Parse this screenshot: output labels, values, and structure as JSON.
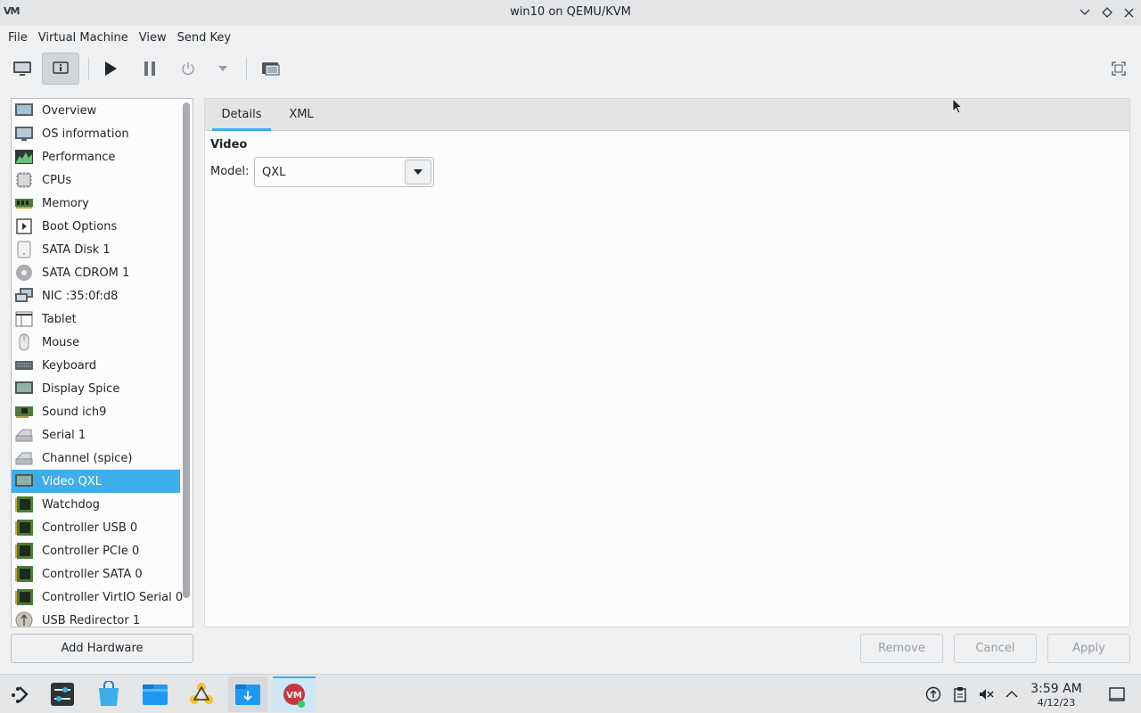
{
  "window": {
    "title": "win10 on QEMU/KVM",
    "logo_text": "VM"
  },
  "menubar": {
    "items": [
      "File",
      "Virtual Machine",
      "View",
      "Send Key"
    ]
  },
  "sidebar": {
    "items": [
      {
        "label": "Overview",
        "icon": "overview-icon"
      },
      {
        "label": "OS information",
        "icon": "os-info-icon"
      },
      {
        "label": "Performance",
        "icon": "performance-icon"
      },
      {
        "label": "CPUs",
        "icon": "cpu-icon"
      },
      {
        "label": "Memory",
        "icon": "memory-icon"
      },
      {
        "label": "Boot Options",
        "icon": "boot-options-icon"
      },
      {
        "label": "SATA Disk 1",
        "icon": "disk-icon"
      },
      {
        "label": "SATA CDROM 1",
        "icon": "cdrom-icon"
      },
      {
        "label": "NIC :35:0f:d8",
        "icon": "nic-icon"
      },
      {
        "label": "Tablet",
        "icon": "tablet-icon"
      },
      {
        "label": "Mouse",
        "icon": "mouse-icon"
      },
      {
        "label": "Keyboard",
        "icon": "keyboard-icon"
      },
      {
        "label": "Display Spice",
        "icon": "display-icon"
      },
      {
        "label": "Sound ich9",
        "icon": "sound-icon"
      },
      {
        "label": "Serial 1",
        "icon": "serial-icon"
      },
      {
        "label": "Channel (spice)",
        "icon": "channel-icon"
      },
      {
        "label": "Video QXL",
        "icon": "video-icon"
      },
      {
        "label": "Watchdog",
        "icon": "watchdog-icon"
      },
      {
        "label": "Controller USB 0",
        "icon": "controller-icon"
      },
      {
        "label": "Controller PCIe 0",
        "icon": "controller-icon"
      },
      {
        "label": "Controller SATA 0",
        "icon": "controller-icon"
      },
      {
        "label": "Controller VirtIO Serial 0",
        "icon": "controller-icon"
      },
      {
        "label": "USB Redirector 1",
        "icon": "usb-redirector-icon"
      }
    ],
    "selected": "Video QXL"
  },
  "tabs": [
    {
      "label": "Details",
      "active": true
    },
    {
      "label": "XML",
      "active": false
    }
  ],
  "details": {
    "section_title": "Video",
    "model_label": "Model:",
    "model_value": "QXL"
  },
  "buttons": {
    "add_hardware": "Add Hardware",
    "remove": "Remove",
    "cancel": "Cancel",
    "apply": "Apply"
  },
  "taskbar": {
    "time": "3:59 AM",
    "date": "4/12/23"
  },
  "colors": {
    "accent": "#3daee9",
    "window_bg": "#eff0f1",
    "view_bg": "#fcfcfc"
  }
}
